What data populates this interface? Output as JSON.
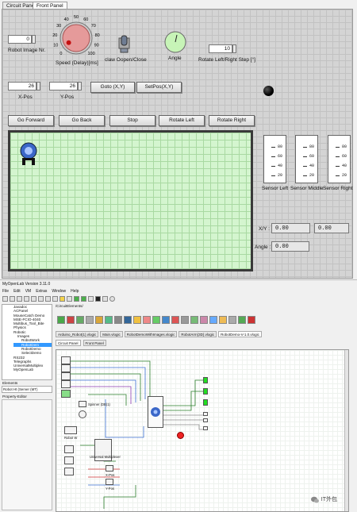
{
  "front_panel": {
    "tabs": [
      {
        "label": "Circuit Panel"
      },
      {
        "label": "Front Panel"
      }
    ],
    "robot_image_nr": {
      "label": "Robot Image Nr.",
      "value": "0"
    },
    "speed": {
      "label": "Speed (Delay)[ms]",
      "ticks": [
        "0",
        "10",
        "20",
        "30",
        "40",
        "50",
        "60",
        "70",
        "80",
        "90",
        "100"
      ],
      "value_fraction": 0.05
    },
    "claw": {
      "label": "claw Oopen/Close"
    },
    "angle": {
      "label": "Angle"
    },
    "step": {
      "label": "Rotate Left/Right Step [°]",
      "value": "10"
    },
    "x_pos": {
      "label": "X-Pos",
      "value": "26"
    },
    "y_pos": {
      "label": "Y-Pos",
      "value": "26"
    },
    "buttons": {
      "goto": "Goto (X,Y)",
      "setpos": "SetPos(X,Y)",
      "forward": "Go Forward",
      "back": "Go Back",
      "stop": "Stop",
      "left": "Rotate Left",
      "right": "Rotate Right"
    },
    "meter_ticks": [
      "80",
      "60",
      "40",
      "20"
    ],
    "sensors": {
      "left": "Sensor Left",
      "middle": "Sensor Middle",
      "right": "Sensor Right"
    },
    "xy": {
      "label": "X/Y :",
      "x": "0.00",
      "y": "0.00"
    },
    "angle_out": {
      "label": "Angle :",
      "value": "0.00"
    }
  },
  "ide": {
    "title": "MyOpenLab Version 3.11.0",
    "menu": [
      "File",
      "Edit",
      "VM",
      "Extras",
      "Window",
      "Help"
    ],
    "tree": [
      "Javadoc",
      "ACPanel",
      "MouseCatch Demo",
      "MSE-FCIO-4040",
      "Multibus_Tool_Bite",
      "Physics",
      "Robotic",
      "Images",
      "RobotWork",
      "RobotDem",
      "RobotDemo",
      "SelectDemo",
      "RS232",
      "Telegraphs",
      "UniversalMultiplex",
      "MyOpenLab"
    ],
    "elements_label": "Elements",
    "robot_item": "Robot Ht (Server (MT)",
    "property_label": "Property-Editor",
    "breadcrumb": "/CircuitElements/",
    "doc_tabs": [
      "Arduino_Robot(1).vlogic",
      "Main.vlogic",
      "RobotDemoWithImages.vlogic",
      "RobotArm(3D).vlogic",
      "RobotDemo-V-1.0.vlogic"
    ],
    "sub_tabs": [
      "Circuit Panel",
      "Front Panel"
    ],
    "blocks": {
      "spinner": "Spinner (DB(1)",
      "robot": "Robot W",
      "multiplexer": "Universal Multiplexer",
      "xpos": "X-Pos",
      "ypos": "Y-Pos"
    },
    "watermark": "IT外包"
  }
}
